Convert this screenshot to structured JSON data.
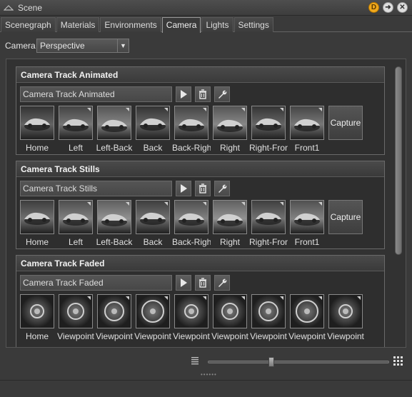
{
  "window": {
    "title": "Scene",
    "badge_d": "D"
  },
  "tabs": [
    "Scenegraph",
    "Materials",
    "Environments",
    "Camera",
    "Lights",
    "Settings"
  ],
  "active_tab": "Camera",
  "camera": {
    "label": "Camera",
    "value": "Perspective"
  },
  "tracks": [
    {
      "header": "Camera Track Animated",
      "name": "Camera Track Animated",
      "viewpoints": [
        "Home",
        "Left",
        "Left-Back",
        "Back",
        "Back-Right",
        "Right",
        "Right-Front",
        "Front1"
      ],
      "capture": "Capture"
    },
    {
      "header": "Camera Track Stills",
      "name": "Camera Track Stills",
      "viewpoints": [
        "Home",
        "Left",
        "Left-Back",
        "Back",
        "Back-Right",
        "Right",
        "Right-Front",
        "Front1"
      ],
      "capture": "Capture"
    },
    {
      "header": "Camera Track Faded",
      "name": "Camera Track Faded",
      "viewpoints": [
        "Home",
        "Viewpoint",
        "Viewpoint",
        "Viewpoint",
        "Viewpoint",
        "Viewpoint",
        "Viewpoint",
        "Viewpoint",
        "Viewpoint"
      ]
    }
  ],
  "icons": {
    "play": "play-icon",
    "delete": "trash-icon",
    "edit": "wrench-icon",
    "list": "list-view-icon",
    "grid": "grid-view-icon"
  },
  "thumbnail_size_fraction": 0.33
}
